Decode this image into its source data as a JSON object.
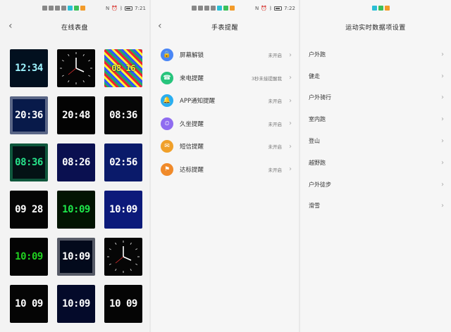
{
  "status": {
    "time_p1": "7:21",
    "time_p2": "7:22"
  },
  "screen_watchfaces": {
    "title": "在线表盘",
    "faces": [
      {
        "time": "12:34",
        "color": "#9ff4ff",
        "bg": "#02101f"
      },
      {
        "time": "",
        "color": "#ffffff",
        "bg": "#050505",
        "kind": "analog"
      },
      {
        "time": "08 16",
        "color": "#f5e93a",
        "bg": "#1b1b4a",
        "kind": "pixel"
      },
      {
        "time": "20:36",
        "color": "#ffffff",
        "bg": "#081a4a",
        "kind": "ring"
      },
      {
        "time": "20:48",
        "color": "#ffffff",
        "bg": "#030303"
      },
      {
        "time": "08:36",
        "color": "#ffffff",
        "bg": "#060606"
      },
      {
        "time": "08:36",
        "color": "#27e28a",
        "bg": "#041215",
        "kind": "ring"
      },
      {
        "time": "08:26",
        "color": "#ffffff",
        "bg": "#0a1050"
      },
      {
        "time": "02:56",
        "color": "#ffffff",
        "bg": "#0a1a6a"
      },
      {
        "time": "09 28",
        "color": "#ffffff",
        "bg": "#050505"
      },
      {
        "time": "10:09",
        "color": "#1ee64a",
        "bg": "#021402"
      },
      {
        "time": "10:09",
        "color": "#ffffff",
        "bg": "#0c1a7a"
      },
      {
        "time": "10:09",
        "color": "#20d020",
        "bg": "#040404"
      },
      {
        "time": "10:09",
        "color": "#ffffff",
        "bg": "#030a1c",
        "kind": "ring"
      },
      {
        "time": "",
        "color": "#ffffff",
        "bg": "#060606",
        "kind": "analog"
      },
      {
        "time": "10 09",
        "color": "#ffffff",
        "bg": "#050505"
      },
      {
        "time": "10:09",
        "color": "#ffffff",
        "bg": "#040a2a"
      },
      {
        "time": "10 09",
        "color": "#ffffff",
        "bg": "#050505"
      }
    ]
  },
  "screen_reminders": {
    "title": "手表提醒",
    "items": [
      {
        "label": "屏幕解锁",
        "value": "未开启",
        "color": "#4a86f5"
      },
      {
        "label": "来电提醒",
        "value": "3秒未接提醒我",
        "color": "#27c47c"
      },
      {
        "label": "APP通知提醒",
        "value": "未开启",
        "color": "#2aaef0"
      },
      {
        "label": "久坐提醒",
        "value": "未开启",
        "color": "#8f6cf0"
      },
      {
        "label": "短信提醒",
        "value": "未开启",
        "color": "#f0a02a"
      },
      {
        "label": "达标提醒",
        "value": "未开启",
        "color": "#f08a2a"
      }
    ]
  },
  "screen_sport_data": {
    "title": "运动实时数据项设置",
    "items": [
      {
        "label": "户外跑"
      },
      {
        "label": "健走"
      },
      {
        "label": "户外骑行"
      },
      {
        "label": "室内跑"
      },
      {
        "label": "登山"
      },
      {
        "label": "越野跑"
      },
      {
        "label": "户外徒步"
      },
      {
        "label": "滑雪"
      }
    ]
  }
}
